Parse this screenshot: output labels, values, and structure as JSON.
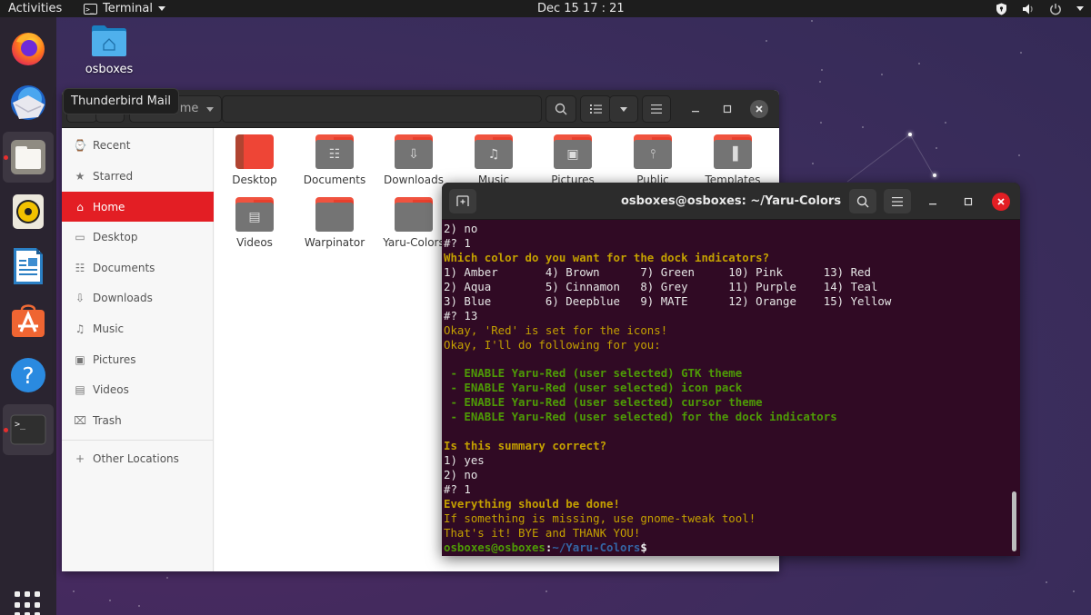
{
  "topbar": {
    "activities": "Activities",
    "app_name": "Terminal",
    "clock": "Dec 15  17 : 21"
  },
  "dock": {
    "items": [
      {
        "name": "Firefox",
        "icon": "firefox-icon",
        "running": false
      },
      {
        "name": "Thunderbird Mail",
        "icon": "thunderbird-icon",
        "running": false
      },
      {
        "name": "Files",
        "icon": "files-icon",
        "running": true
      },
      {
        "name": "Rhythmbox",
        "icon": "rhythmbox-icon",
        "running": false
      },
      {
        "name": "LibreOffice Writer",
        "icon": "writer-icon",
        "running": false
      },
      {
        "name": "Ubuntu Software",
        "icon": "software-icon",
        "running": false
      },
      {
        "name": "Help",
        "icon": "help-icon",
        "running": false
      },
      {
        "name": "Terminal",
        "icon": "terminal-icon",
        "running": true
      }
    ],
    "show_apps": "Show Applications",
    "accent": "#e62e2e"
  },
  "tooltip": "Thunderbird Mail",
  "desktop": {
    "icon_label": "osboxes"
  },
  "files": {
    "path": "Home",
    "sidebar": [
      {
        "label": "Recent",
        "icon": "⌚"
      },
      {
        "label": "Starred",
        "icon": "★"
      },
      {
        "label": "Home",
        "icon": "⌂",
        "selected": true
      },
      {
        "label": "Desktop",
        "icon": "▭"
      },
      {
        "label": "Documents",
        "icon": "☷"
      },
      {
        "label": "Downloads",
        "icon": "⇩"
      },
      {
        "label": "Music",
        "icon": "♫"
      },
      {
        "label": "Pictures",
        "icon": "▣"
      },
      {
        "label": "Videos",
        "icon": "▤"
      },
      {
        "label": "Trash",
        "icon": "⌧"
      }
    ],
    "other_locations": "Other Locations",
    "folders": [
      {
        "label": "Desktop",
        "glyph": ""
      },
      {
        "label": "Documents",
        "glyph": "☷"
      },
      {
        "label": "Downloads",
        "glyph": "⇩"
      },
      {
        "label": "Music",
        "glyph": "♫"
      },
      {
        "label": "Pictures",
        "glyph": "▣"
      },
      {
        "label": "Public",
        "glyph": "⫯"
      },
      {
        "label": "Templates",
        "glyph": "▐"
      },
      {
        "label": "Videos",
        "glyph": "▤"
      },
      {
        "label": "Warpinator",
        "glyph": ""
      },
      {
        "label": "Yaru-Colors",
        "glyph": ""
      }
    ],
    "accent": "#e31e24"
  },
  "terminal": {
    "title": "osboxes@osboxes: ~/Yaru-Colors",
    "lines": [
      {
        "t": "2) no",
        "c": ""
      },
      {
        "t": "#? 1",
        "c": ""
      },
      {
        "t": "Which color do you want for the dock indicators?",
        "c": "c-yellow"
      },
      {
        "t": "1) Amber       4) Brown      7) Green     10) Pink      13) Red",
        "c": ""
      },
      {
        "t": "2) Aqua        5) Cinnamon   8) Grey      11) Purple    14) Teal",
        "c": ""
      },
      {
        "t": "3) Blue        6) Deepblue   9) MATE      12) Orange    15) Yellow",
        "c": ""
      },
      {
        "t": "#? 13",
        "c": ""
      },
      {
        "t": "Okay, 'Red' is set for the icons!",
        "c": "c-yellow-n"
      },
      {
        "t": "Okay, I'll do following for you:",
        "c": "c-yellow-n"
      },
      {
        "t": "",
        "c": ""
      },
      {
        "t": " - ENABLE Yaru-Red (user selected) GTK theme",
        "c": "c-green"
      },
      {
        "t": " - ENABLE Yaru-Red (user selected) icon pack",
        "c": "c-green"
      },
      {
        "t": " - ENABLE Yaru-Red (user selected) cursor theme",
        "c": "c-green"
      },
      {
        "t": " - ENABLE Yaru-Red (user selected) for the dock indicators",
        "c": "c-green"
      },
      {
        "t": "",
        "c": ""
      },
      {
        "t": "Is this summary correct?",
        "c": "c-yellow"
      },
      {
        "t": "1) yes",
        "c": ""
      },
      {
        "t": "2) no",
        "c": ""
      },
      {
        "t": "#? 1",
        "c": ""
      },
      {
        "t": "Everything should be done!",
        "c": "c-yellow"
      },
      {
        "t": "If something is missing, use gnome-tweak tool!",
        "c": "c-yellow-n"
      },
      {
        "t": "That's it! BYE and THANK YOU!",
        "c": "c-yellow-n"
      }
    ],
    "prompt": {
      "user": "osboxes@osboxes",
      "sep": ":",
      "path": "~/Yaru-Colors",
      "symbol": "$"
    },
    "colors": {
      "background": "#300a24",
      "yellow": "#c4a000",
      "green": "#4e9a06",
      "blue": "#3465a4"
    }
  }
}
